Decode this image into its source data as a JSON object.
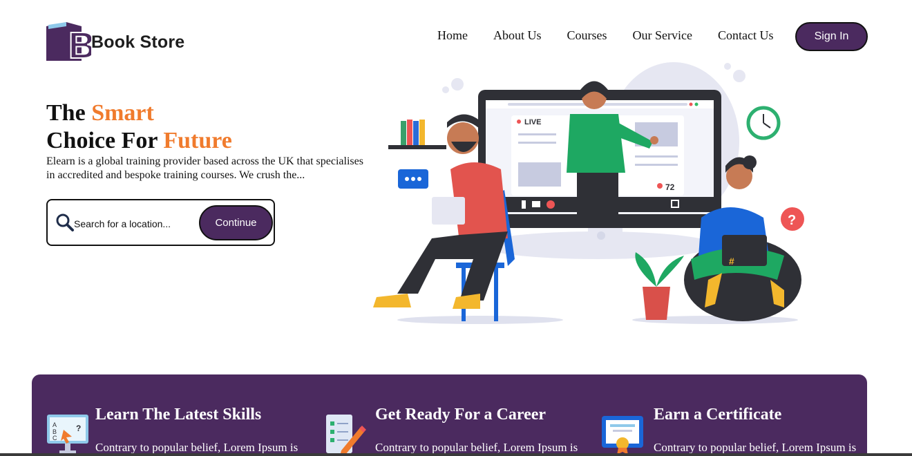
{
  "brand": {
    "name": "Book Store",
    "logo_letter": "B",
    "color": "#4b2a5f"
  },
  "nav": {
    "items": [
      "Home",
      "About Us",
      "Courses",
      "Our Service",
      "Contact Us"
    ],
    "signin_label": "Sign In"
  },
  "hero": {
    "title_line1_prefix": "The ",
    "title_line1_accent": "Smart",
    "title_line2_prefix": "Choice For ",
    "title_line2_accent": "Future",
    "description": "Elearn is a global training provider based across the UK that specialises in accredited and bespoke training courses. We crush the...",
    "search": {
      "placeholder": "Search for a location...",
      "button_label": "Continue",
      "icon": "search-icon"
    },
    "illustration": {
      "live_label": "LIVE",
      "viewer_count": "72",
      "icon": "online-class-illustration"
    }
  },
  "features": [
    {
      "title": "Learn The Latest Skills",
      "text": "Contrary to popular belief, Lorem Ipsum is",
      "icon": "abc-lesson-icon"
    },
    {
      "title": "Get Ready For a Career",
      "text": "Contrary to popular belief, Lorem Ipsum is",
      "icon": "checklist-pencil-icon"
    },
    {
      "title": "Earn a Certificate",
      "text": "Contrary to popular belief, Lorem Ipsum is",
      "icon": "certificate-icon"
    }
  ],
  "colors": {
    "accent": "#f07b2d",
    "primary": "#4b2a5f"
  }
}
